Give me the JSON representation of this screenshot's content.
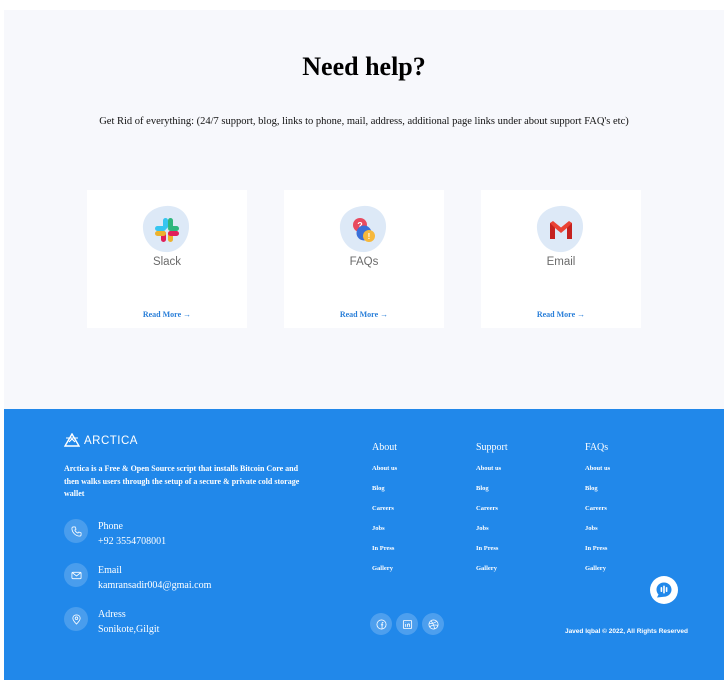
{
  "help": {
    "title": "Need help?",
    "subtitle": "Get Rid of everything: (24/7 support, blog, links to phone, mail, address, additional page links under about support FAQ's etc)",
    "cards": [
      {
        "label": "Slack",
        "icon": "slack-logo-icon",
        "link": "Read More"
      },
      {
        "label": "FAQs",
        "icon": "faq-bubbles-icon",
        "link": "Read More"
      },
      {
        "label": "Email",
        "icon": "gmail-logo-icon",
        "link": "Read More"
      }
    ]
  },
  "footer": {
    "brand": "ARCTICA",
    "description": "Arctica is a Free & Open Source script that installs Bitcoin Core and then walks users through the setup of a secure & private cold storage wallet",
    "contacts": [
      {
        "label": "Phone",
        "value": "+92 3554708001",
        "icon": "phone-icon"
      },
      {
        "label": "Email",
        "value": "kamransadir004@gmai.com",
        "icon": "mail-icon"
      },
      {
        "label": "Adress",
        "value": "Sonikote,Gilgit",
        "icon": "location-pin-icon"
      }
    ],
    "columns": [
      {
        "title": "About",
        "items": [
          "About us",
          "Blog",
          "Careers",
          "Jobs",
          "In Press",
          "Gallery"
        ]
      },
      {
        "title": "Support",
        "items": [
          "About us",
          "Blog",
          "Careers",
          "Jobs",
          "In Press",
          "Gallery"
        ]
      },
      {
        "title": "FAQs",
        "items": [
          "About us",
          "Blog",
          "Careers",
          "Jobs",
          "In Press",
          "Gallery"
        ]
      }
    ],
    "socials": [
      "facebook-icon",
      "linkedin-icon",
      "dribbble-icon"
    ],
    "copyright": "Javed Iqbal © 2022, All Rights Reserved"
  },
  "colors": {
    "footer_bg": "#2188ea",
    "link": "#2a7fd9",
    "section_bg": "#f7f8fc"
  }
}
